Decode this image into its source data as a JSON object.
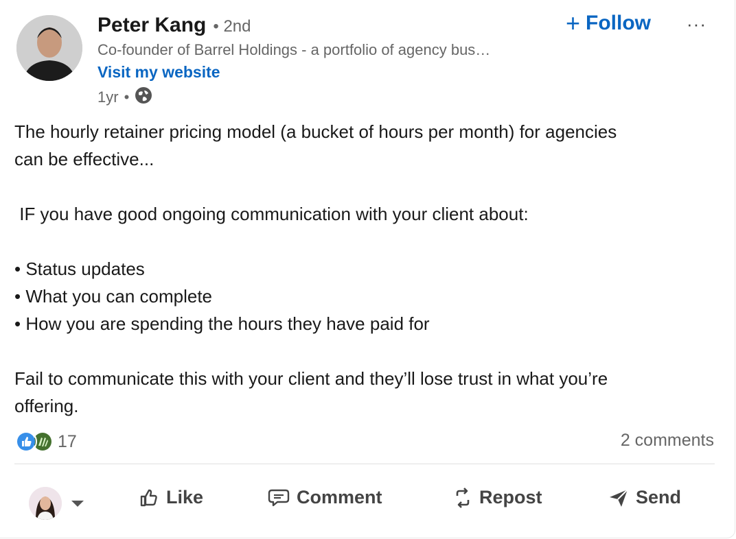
{
  "author": {
    "name": "Peter Kang",
    "degree": "• 2nd",
    "headline": "Co-founder of Barrel Holdings - a portfolio of agency bus…",
    "website_label": "Visit my website",
    "time": "1yr",
    "visibility_icon": "globe-icon"
  },
  "follow_label": "Follow",
  "more_label": "···",
  "post": {
    "line1": "The hourly retainer pricing model (a bucket of hours per month) for agencies",
    "line2": "can be effective...",
    "line3": " IF you have good ongoing communication with your client about:",
    "bullets": [
      "• Status updates",
      "• What you can complete",
      "• How you are spending the hours they have paid for"
    ],
    "line4": "Fail to communicate this with your client and they’ll lose trust in what you’re",
    "line5": "offering."
  },
  "social": {
    "reaction_count": "17",
    "reaction_icons": [
      "like-reaction-icon",
      "celebrate-reaction-icon"
    ],
    "comments_label": "2 comments"
  },
  "actions": {
    "like": "Like",
    "comment": "Comment",
    "repost": "Repost",
    "send": "Send"
  },
  "colors": {
    "accent": "#0a66c2",
    "text": "#191919",
    "muted": "#666666"
  }
}
